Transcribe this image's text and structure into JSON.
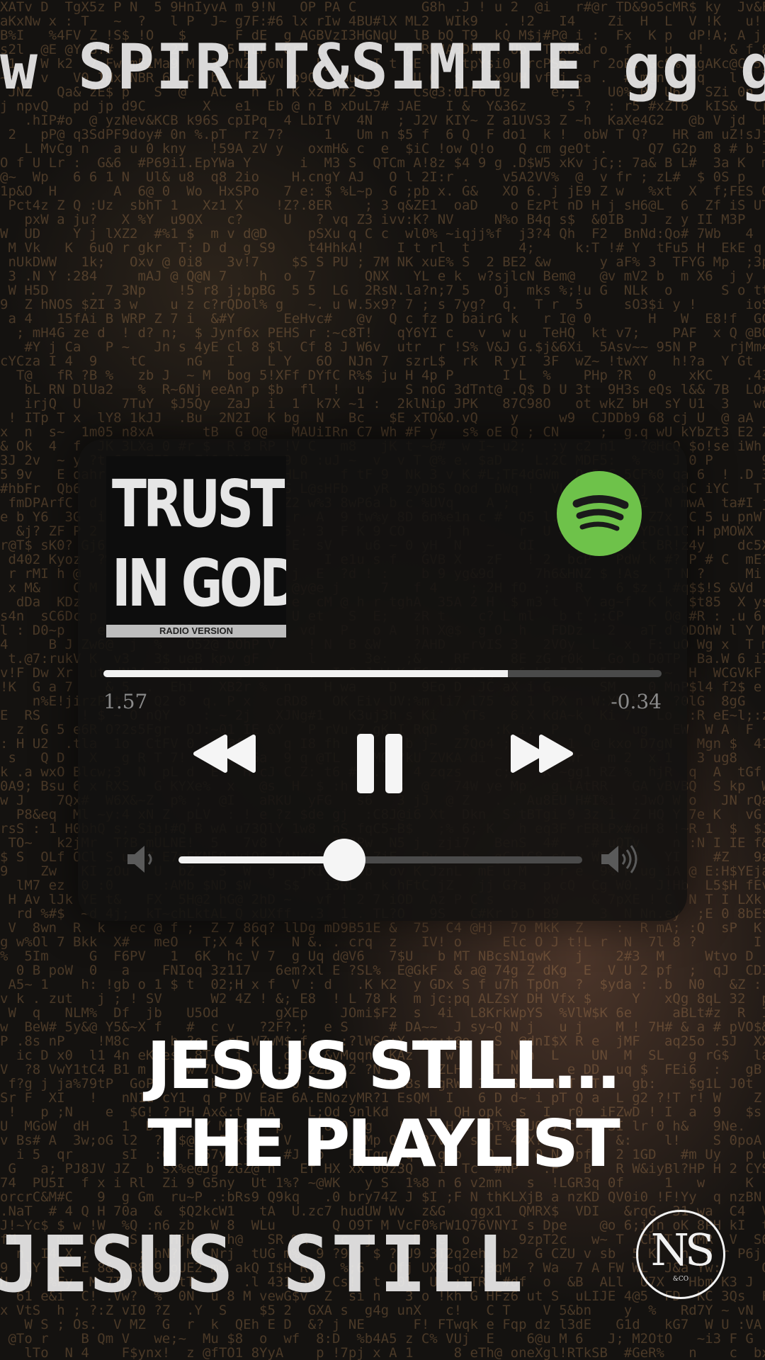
{
  "cover": {
    "title_line1": "TRUST",
    "title_line2": "IN GOD",
    "subtitle": "RADIO VERSION"
  },
  "player": {
    "progress_fraction": 0.725,
    "elapsed": "1.57",
    "remaining": "-0.34",
    "volume_fraction": 0.41,
    "controls": {
      "rewind_icon": "rewind-icon",
      "pause_icon": "pause-icon",
      "forward_icon": "fast-forward-icon",
      "volume_low_icon": "volume-low-icon",
      "volume_high_icon": "volume-high-icon"
    },
    "brand_icon": "spotify-icon"
  },
  "headline": {
    "line1": "JESUS STILL...",
    "line2": "THE PLAYLIST"
  },
  "logo": {
    "main": "NS",
    "sub": "&CO"
  },
  "background": {
    "band_top": "w SPIRIT&SIMITE gg gg gg",
    "band_bottom": "JESUS STILL"
  },
  "colors": {
    "spotify_green": "#6ec24a",
    "panel": "#121110",
    "text": "#ffffff"
  }
}
